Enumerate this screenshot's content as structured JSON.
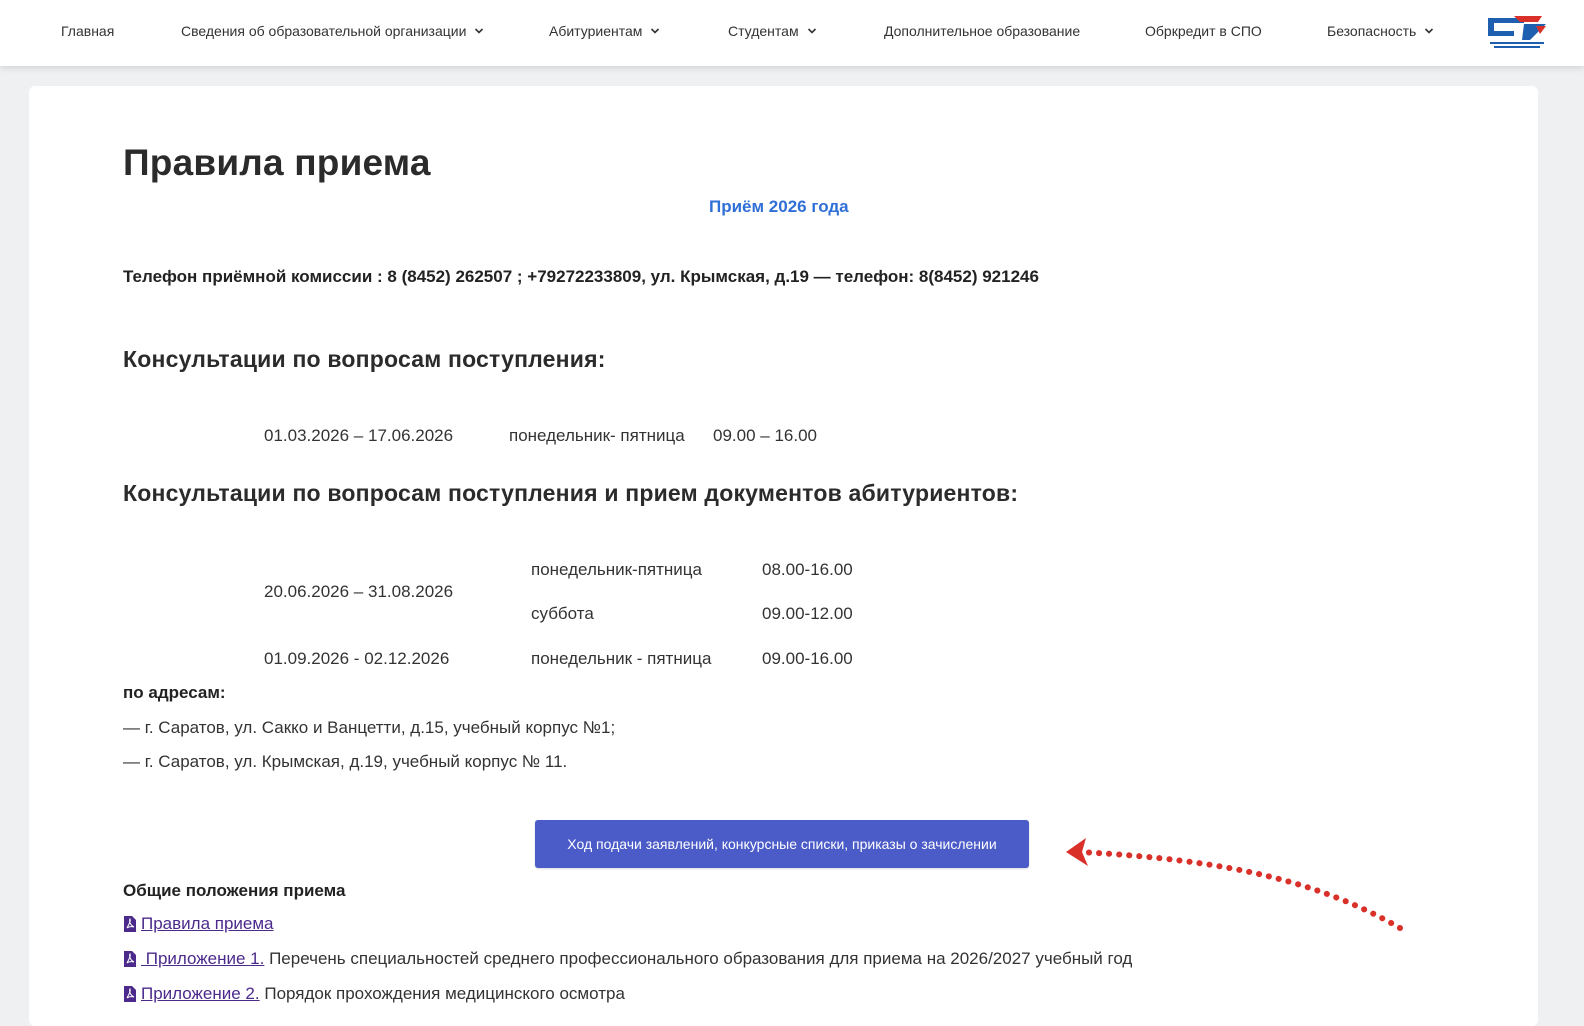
{
  "nav": {
    "home": "Главная",
    "org_info": "Сведения об образовательной организации",
    "applicants": "Абитуриентам",
    "students": "Студентам",
    "extra_edu": "Дополнительное образование",
    "credit": "Обркредит в СПО",
    "security": "Безопасность"
  },
  "page": {
    "title": "Правила приема",
    "subtitle": "Приём 2026 года",
    "phone": "Телефон приёмной комиссии : 8 (8452) 262507 ; +79272233809, ул. Крымская, д.19 — телефон: 8(8452) 921246",
    "section1_title": "Консультации по вопросам поступления:",
    "section1_row": {
      "dates": "01.03.2026 – 17.06.2026",
      "days": "понедельник- пятница",
      "hours": "09.00 – 16.00"
    },
    "section2_title": "Консультации по вопросам поступления и прием документов абитуриентов:",
    "schedule": {
      "period1": "20.06.2026 – 31.08.2026",
      "row1_days": "понедельник-пятница",
      "row1_hours": "08.00-16.00",
      "row2_days": "суббота",
      "row2_hours": "09.00-12.00",
      "period2": "01.09.2026 - 02.12.2026",
      "row3_days": "понедельник - пятница",
      "row3_hours": "09.00-16.00"
    },
    "addresses_label": "по адресам:",
    "address1": "— г. Саратов, ул. Сакко и Ванцетти, д.15, учебный корпус №1;",
    "address2": "— г. Саратов, ул. Крымская, д.19, учебный корпус № 11.",
    "cta_button": "Ход подачи заявлений, конкурсные списки, приказы о зачислении",
    "general_title": "Общие положения приема",
    "docs": [
      {
        "link": "Правила приема",
        "text": ""
      },
      {
        "link": " Приложение 1.",
        "text": " Перечень специальностей среднего профессионального образования для приема на 2026/2027 учебный год"
      },
      {
        "link": "Приложение 2.",
        "text": " Порядок прохождения медицинского осмотра"
      }
    ]
  },
  "colors": {
    "accent_blue": "#2f6fd6",
    "button": "#4b5bc7",
    "link": "#4b2a8c",
    "arrow": "#d9302a"
  }
}
